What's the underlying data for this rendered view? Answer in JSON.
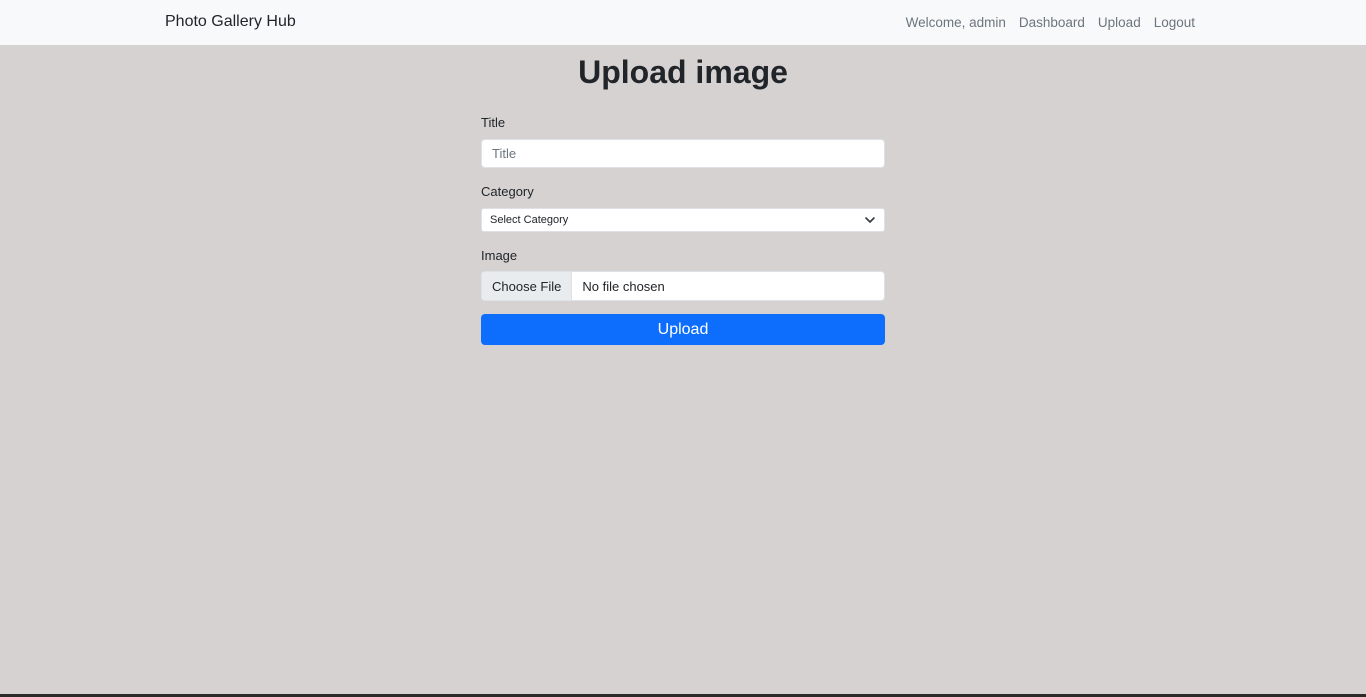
{
  "navbar": {
    "brand": "Photo Gallery Hub",
    "links": [
      {
        "label": "Welcome, admin"
      },
      {
        "label": "Dashboard"
      },
      {
        "label": "Upload"
      },
      {
        "label": "Logout"
      }
    ]
  },
  "page": {
    "title": "Upload image"
  },
  "form": {
    "title_label": "Title",
    "title_placeholder": "Title",
    "title_value": "",
    "category_label": "Category",
    "category_selected": "Select Category",
    "image_label": "Image",
    "file_button": "Choose File",
    "file_status": "No file chosen",
    "submit_label": "Upload"
  },
  "icons": {
    "select_arrow": "chevron-down-icon"
  },
  "colors": {
    "background": "#d6d2d2",
    "navbar_bg": "#f8f9fa",
    "primary": "#0d6efd",
    "muted_link": "#6c757d"
  }
}
